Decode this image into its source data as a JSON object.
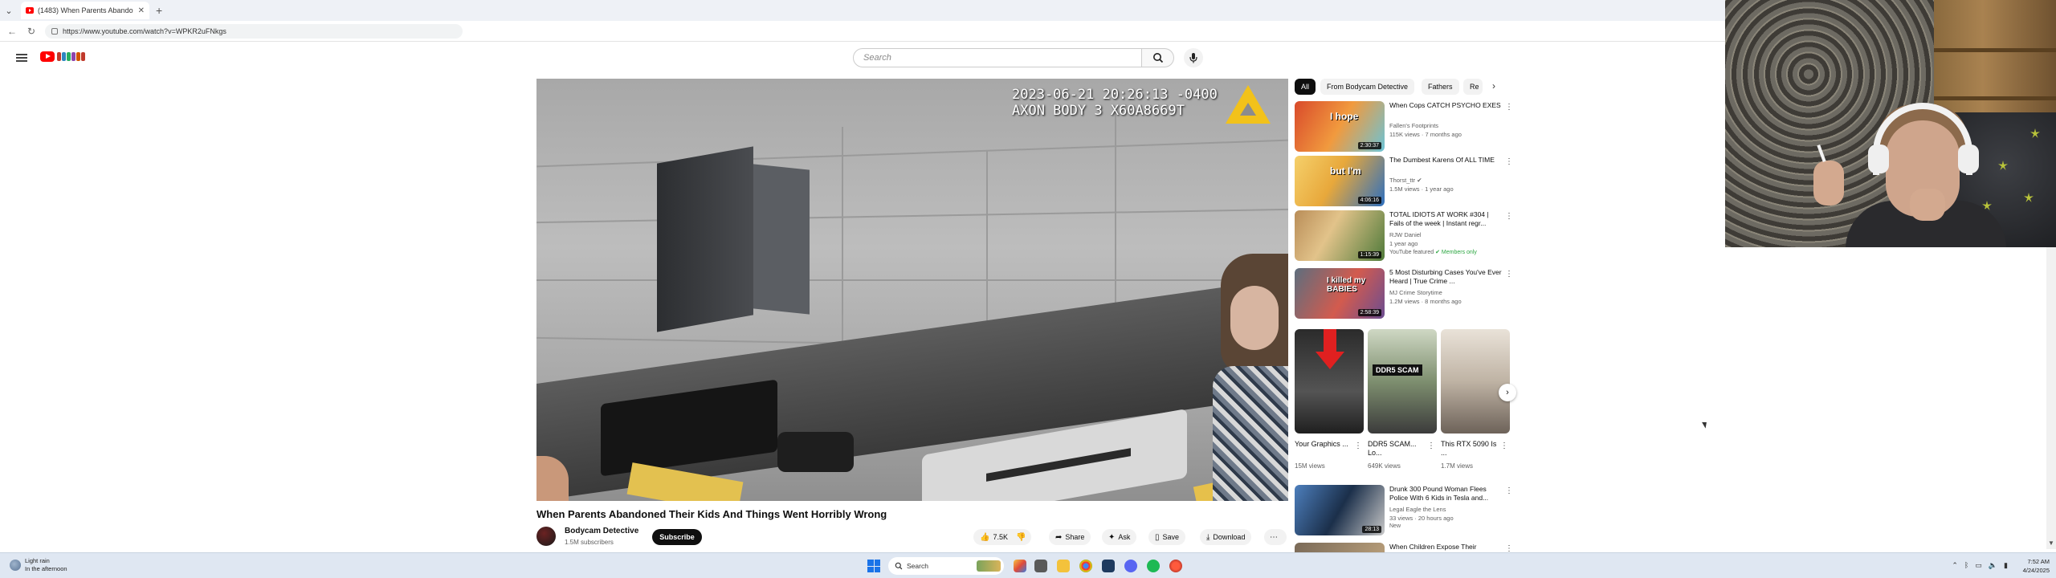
{
  "browser": {
    "tab_title": "(1483) When Parents Abando",
    "url": "https://www.youtube.com/watch?v=WPKR2uFNkgs"
  },
  "youtube": {
    "search_placeholder": "Search"
  },
  "player": {
    "osd_line1": "2023-06-21 20:26:13 -0400",
    "osd_line2": "AXON BODY 3 X60A8669T"
  },
  "video": {
    "title": "When Parents Abandoned Their Kids And Things Went Horribly Wrong",
    "channel": "Bodycam Detective",
    "subscribers": "1.5M subscribers",
    "subscribe_label": "Subscribe",
    "likes": "7.5K",
    "share_label": "Share",
    "ask_label": "Ask",
    "save_label": "Save",
    "download_label": "Download"
  },
  "chips": [
    "All",
    "From Bodycam Detective",
    "Fathers",
    "Re"
  ],
  "related": [
    {
      "title": "When Cops CATCH PSYCHO EXES",
      "channel": "Fallen's Footprints",
      "meta": "115K views · 7 months ago",
      "duration": "2:30:37",
      "thumb_text": "I hope",
      "badge": "",
      "members": ""
    },
    {
      "title": "The Dumbest Karens Of ALL TIME",
      "channel": "Thorst_ttr",
      "meta": "1.5M views · 1 year ago",
      "duration": "4:06:16",
      "thumb_text": "but I'm",
      "badge": "",
      "members": ""
    },
    {
      "title": "TOTAL IDIOTS AT WORK #304 | Fails of the week | Instant regr...",
      "channel": "RJW Daniel",
      "meta": "1 year ago",
      "duration": "1:15:39",
      "thumb_text": "",
      "badge": "YouTube featured",
      "members": "Members only"
    },
    {
      "title": "5 Most Disturbing Cases You've Ever Heard | True Crime ...",
      "channel": "MJ Crime Storytime",
      "meta": "1.2M views · 8 months ago",
      "duration": "2:58:39",
      "thumb_text": "I killed my BABIES",
      "badge": "",
      "members": ""
    },
    {
      "title": "Drunk 300 Pound Woman Flees Police With 6 Kids in Tesla and...",
      "channel": "Legal Eagle the Lens",
      "meta": "33 views · 20 hours ago",
      "duration": "28:13",
      "thumb_text": "",
      "badge": "New",
      "members": ""
    },
    {
      "title": "When Children Expose Their",
      "channel": "",
      "meta": "",
      "duration": "",
      "thumb_text": "",
      "badge": "",
      "members": ""
    }
  ],
  "shorts": [
    {
      "title": "Your Graphics ...",
      "views": "15M views"
    },
    {
      "title": "DDR5 SCAM... Lo...",
      "views": "649K views",
      "thumb_text": "DDR5 SCAM"
    },
    {
      "title": "This RTX 5090 Is ...",
      "views": "1.7M views"
    }
  ],
  "taskbar": {
    "weather_line1": "Light rain",
    "weather_line2": "In the afternoon",
    "search_label": "Search",
    "time": "7:52 AM",
    "date": "4/24/2025"
  },
  "colors": {
    "youtube_red": "#ff0000",
    "members_green": "#2ba640",
    "axon_yellow": "#f2c21a"
  }
}
